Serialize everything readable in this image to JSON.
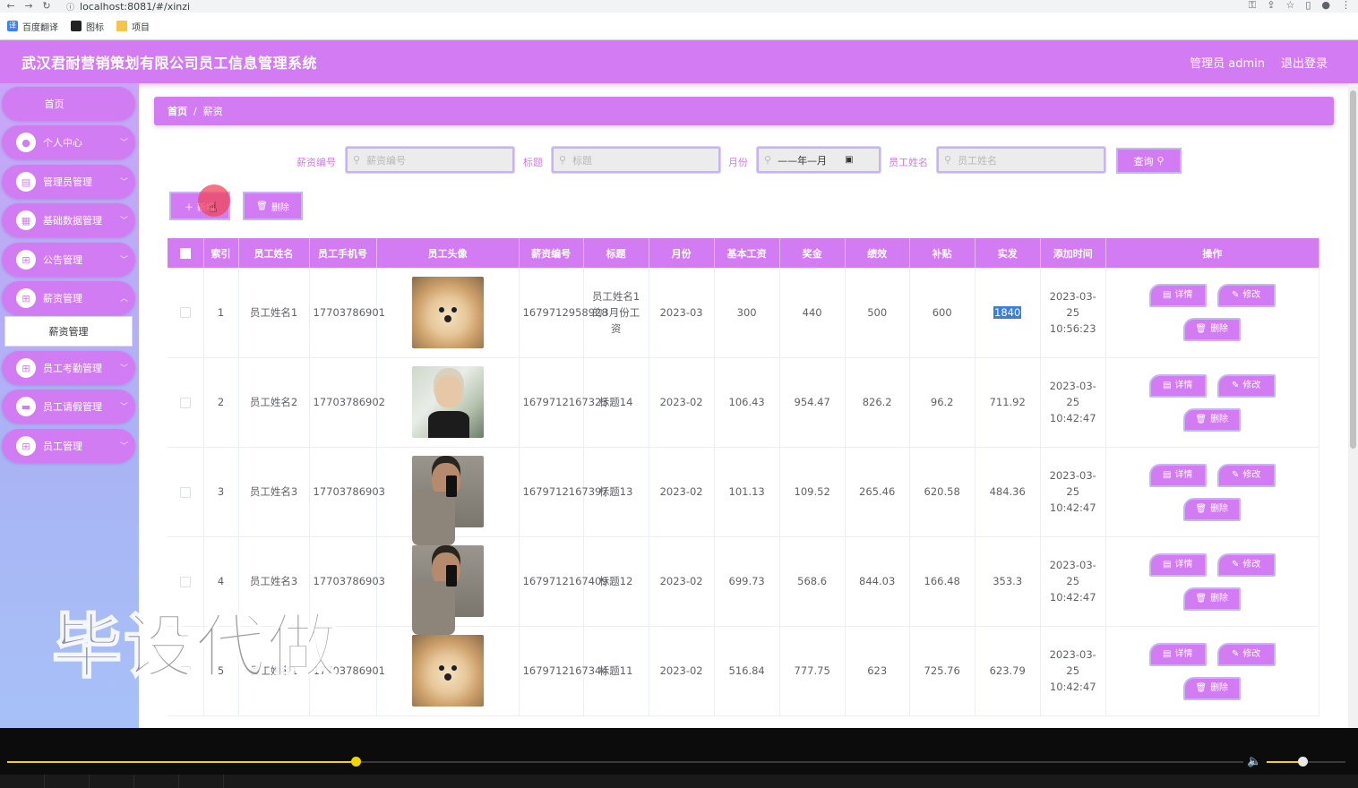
{
  "browser": {
    "url": "localhost:8081/#/xinzi",
    "bookmarks": [
      "百度翻译",
      "图标",
      "项目"
    ]
  },
  "header": {
    "title": "武汉君耐营销策划有限公司员工信息管理系统",
    "user_label": "管理员 admin",
    "logout_label": "退出登录"
  },
  "sidebar": {
    "items": [
      {
        "label": "首页"
      },
      {
        "label": "个人中心"
      },
      {
        "label": "管理员管理"
      },
      {
        "label": "基础数据管理"
      },
      {
        "label": "公告管理"
      },
      {
        "label": "薪资管理"
      },
      {
        "label": "员工考勤管理"
      },
      {
        "label": "员工请假管理"
      },
      {
        "label": "员工管理"
      }
    ],
    "submenu_active": "薪资管理"
  },
  "breadcrumb": {
    "home": "首页",
    "current": "薪资"
  },
  "search": {
    "fields": [
      {
        "label": "薪资编号",
        "placeholder": "薪资编号"
      },
      {
        "label": "标题",
        "placeholder": "标题"
      },
      {
        "label": "月份",
        "value": "——年—月"
      },
      {
        "label": "员工姓名",
        "placeholder": "员工姓名"
      }
    ],
    "query_label": "查询"
  },
  "actions": {
    "add_label": "新增",
    "delete_label": "删除"
  },
  "table": {
    "columns": [
      "索引",
      "员工姓名",
      "员工手机号",
      "员工头像",
      "薪资编号",
      "标题",
      "月份",
      "基本工资",
      "奖金",
      "绩效",
      "补贴",
      "实发",
      "添加时间",
      "操作"
    ],
    "rows": [
      {
        "index": "1",
        "name": "员工姓名1",
        "phone": "17703786901",
        "avatar": "dog",
        "salary_no": "1679712958928",
        "title": "员工姓名1的3月份工资",
        "month": "2023-03",
        "base": "300",
        "bonus": "440",
        "perf": "500",
        "subsidy": "600",
        "actual": "1840",
        "time": "2023-03-25 10:56:23"
      },
      {
        "index": "2",
        "name": "员工姓名2",
        "phone": "17703786902",
        "avatar": "person1",
        "salary_no": "1679712167323",
        "title": "标题14",
        "month": "2023-02",
        "base": "106.43",
        "bonus": "954.47",
        "perf": "826.2",
        "subsidy": "96.2",
        "actual": "711.92",
        "time": "2023-03-25 10:42:47"
      },
      {
        "index": "3",
        "name": "员工姓名3",
        "phone": "17703786903",
        "avatar": "person2",
        "salary_no": "1679712167397",
        "title": "标题13",
        "month": "2023-02",
        "base": "101.13",
        "bonus": "109.52",
        "perf": "265.46",
        "subsidy": "620.58",
        "actual": "484.36",
        "time": "2023-03-25 10:42:47"
      },
      {
        "index": "4",
        "name": "员工姓名3",
        "phone": "17703786903",
        "avatar": "person2",
        "salary_no": "1679712167409",
        "title": "标题12",
        "month": "2023-02",
        "base": "699.73",
        "bonus": "568.6",
        "perf": "844.03",
        "subsidy": "166.48",
        "actual": "353.3",
        "time": "2023-03-25 10:42:47"
      },
      {
        "index": "5",
        "name": "员工姓名1",
        "phone": "17703786901",
        "avatar": "dog",
        "salary_no": "1679712167344",
        "title": "标题11",
        "month": "2023-02",
        "base": "516.84",
        "bonus": "777.75",
        "perf": "623",
        "subsidy": "725.76",
        "actual": "623.79",
        "time": "2023-03-25 10:42:47"
      }
    ],
    "op_labels": {
      "detail": "详情",
      "edit": "修改",
      "delete": "删除"
    }
  },
  "watermark": "毕设代做",
  "player": {
    "progress": 0.282,
    "volume": 0.45,
    "accent": "#f3d400"
  },
  "colors": {
    "accent": "#d27bf3",
    "accent_border": "#c9b4f3"
  }
}
